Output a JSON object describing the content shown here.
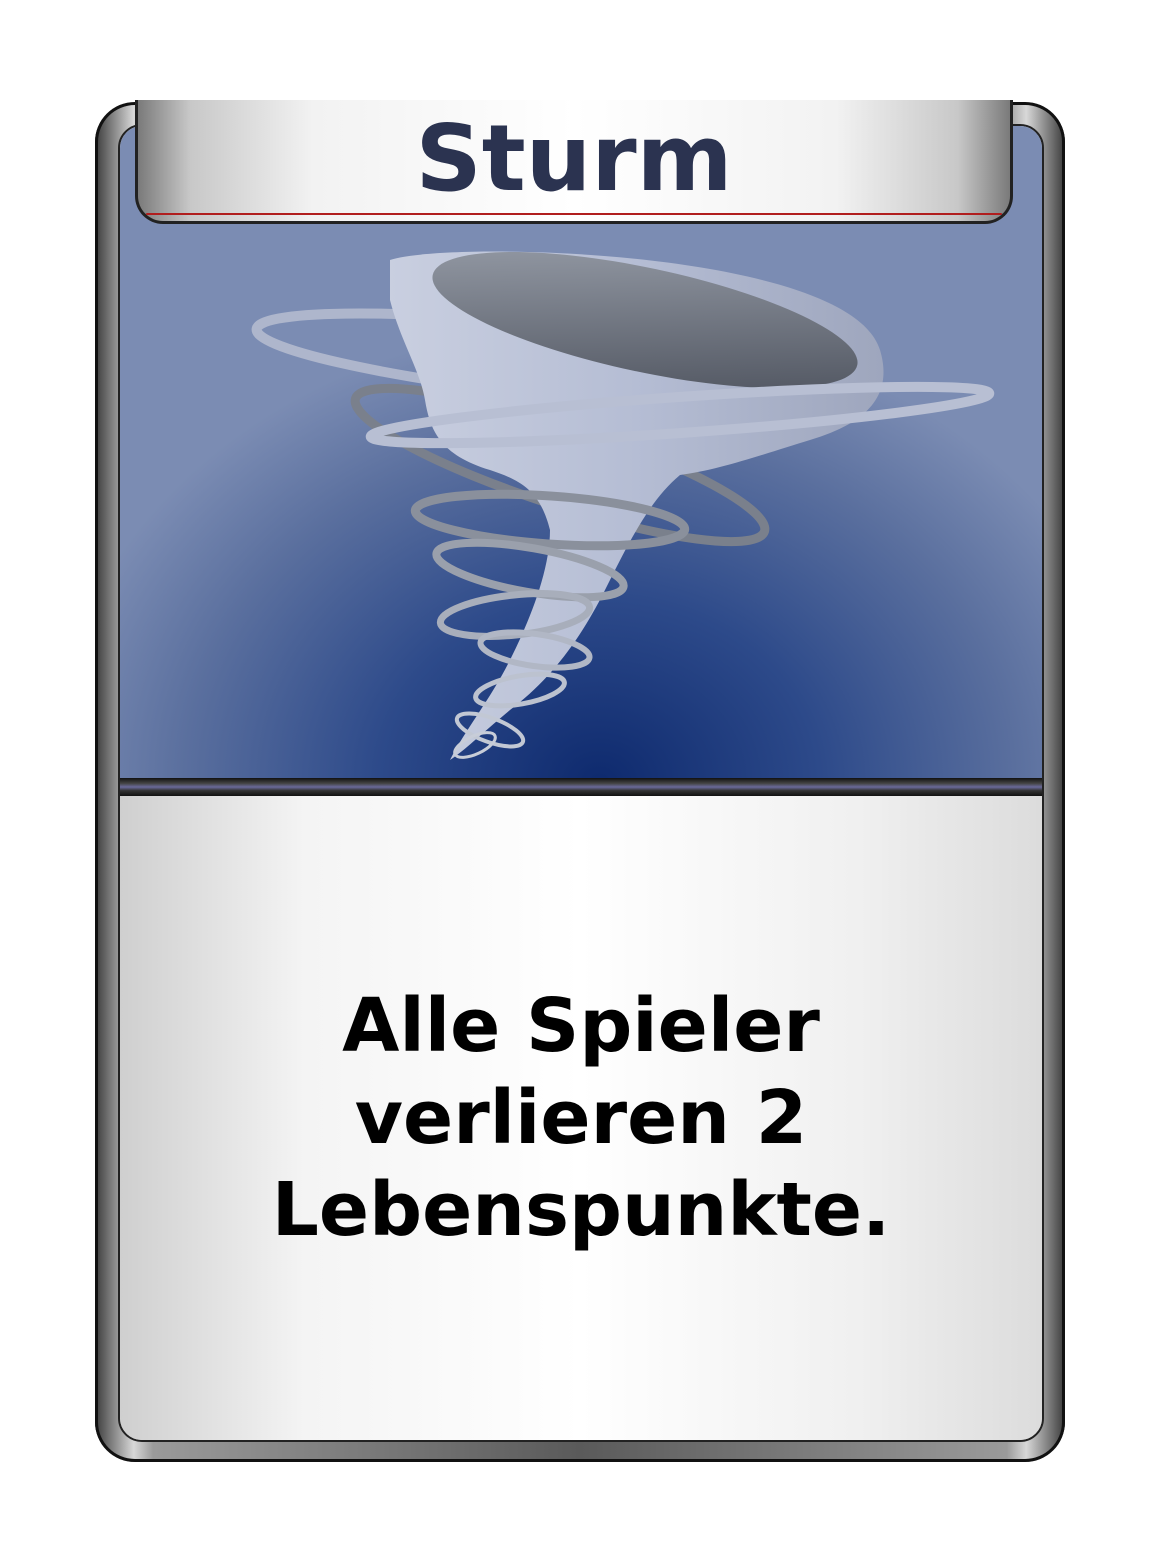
{
  "card": {
    "title": "Sturm",
    "text_lines": [
      "Alle Spieler",
      "verlieren 2",
      "Lebenspunkte."
    ],
    "art_icon": "tornado-icon",
    "colors": {
      "title_text": "#2b3350",
      "art_background": "#2d4a8a",
      "accent_line": "#b11e1e",
      "body_text": "#000000"
    }
  }
}
